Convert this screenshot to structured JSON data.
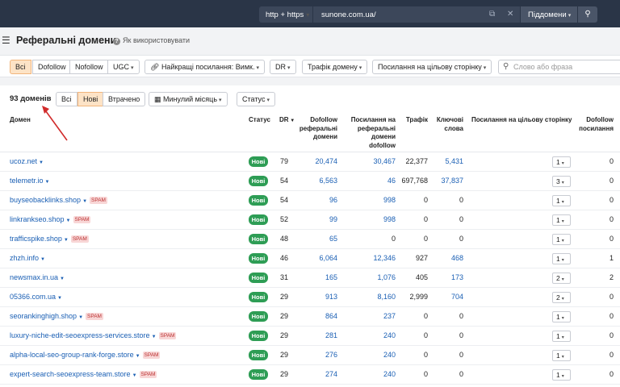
{
  "topbar": {
    "protocol": "http + https",
    "url": "sunone.com.ua/",
    "scope": "Піддомени"
  },
  "header": {
    "title": "Реферальні домени",
    "howto": "Як використовувати"
  },
  "filters": {
    "link_types": [
      "Всі",
      "Dofollow",
      "Nofollow",
      "UGC"
    ],
    "best_links": "Найкращі посилання: Вимк.",
    "dr": "DR",
    "traffic": "Трафік домену",
    "target_links": "Посилання на цільову сторінку",
    "phrase_placeholder": "Слово або фраза"
  },
  "panel": {
    "count": "93 доменів",
    "tabs": [
      "Всі",
      "Нові",
      "Втрачено"
    ],
    "period": "Минулий місяць",
    "status": "Статус"
  },
  "columns": {
    "domain": "Домен",
    "status": "Статус",
    "dr": "DR",
    "dofollow": [
      "Dofollow",
      "реферальні",
      "домени"
    ],
    "links": [
      "Посилання на",
      "реферальні",
      "домени",
      "dofollow"
    ],
    "traffic": "Трафік",
    "keywords": [
      "Ключові",
      "слова"
    ],
    "target": "Посилання на цільову сторінку",
    "dofollow_links": [
      "Dofollow",
      "посилання"
    ]
  },
  "rows": [
    {
      "domain": "ucoz.net",
      "spam": "",
      "status": "Нові",
      "dr": "79",
      "dofollow": "20,474",
      "links": "30,467",
      "traffic": "22,377",
      "keywords": "5,431",
      "target": "1",
      "df_links": "0"
    },
    {
      "domain": "telemetr.io",
      "spam": "",
      "status": "Нові",
      "dr": "54",
      "dofollow": "6,563",
      "links": "46",
      "traffic": "697,768",
      "keywords": "37,837",
      "target": "3",
      "df_links": "0"
    },
    {
      "domain": "buyseobacklinks.shop",
      "spam": "SPAM",
      "status": "Нові",
      "dr": "54",
      "dofollow": "96",
      "links": "998",
      "traffic": "0",
      "keywords": "0",
      "target": "1",
      "df_links": "0"
    },
    {
      "domain": "linkrankseo.shop",
      "spam": "SPAM",
      "status": "Нові",
      "dr": "52",
      "dofollow": "99",
      "links": "998",
      "traffic": "0",
      "keywords": "0",
      "target": "1",
      "df_links": "0"
    },
    {
      "domain": "trafficspike.shop",
      "spam": "SPAM",
      "status": "Нові",
      "dr": "48",
      "dofollow": "65",
      "links": "0",
      "traffic": "0",
      "keywords": "0",
      "target": "1",
      "df_links": "0"
    },
    {
      "domain": "zhzh.info",
      "spam": "",
      "status": "Нові",
      "dr": "46",
      "dofollow": "6,064",
      "links": "12,346",
      "traffic": "927",
      "keywords": "468",
      "target": "1",
      "df_links": "1"
    },
    {
      "domain": "newsmax.in.ua",
      "spam": "",
      "status": "Нові",
      "dr": "31",
      "dofollow": "165",
      "links": "1,076",
      "traffic": "405",
      "keywords": "173",
      "target": "2",
      "df_links": "2"
    },
    {
      "domain": "05366.com.ua",
      "spam": "",
      "status": "Нові",
      "dr": "29",
      "dofollow": "913",
      "links": "8,160",
      "traffic": "2,999",
      "keywords": "704",
      "target": "2",
      "df_links": "0"
    },
    {
      "domain": "seorankinghigh.shop",
      "spam": "SPAM",
      "status": "Нові",
      "dr": "29",
      "dofollow": "864",
      "links": "237",
      "traffic": "0",
      "keywords": "0",
      "target": "1",
      "df_links": "0"
    },
    {
      "domain": "luxury-niche-edit-seoexpress-services.store",
      "spam": "SPAM",
      "status": "Нові",
      "dr": "29",
      "dofollow": "281",
      "links": "240",
      "traffic": "0",
      "keywords": "0",
      "target": "1",
      "df_links": "0"
    },
    {
      "domain": "alpha-local-seo-group-rank-forge.store",
      "spam": "SPAM",
      "status": "Нові",
      "dr": "29",
      "dofollow": "276",
      "links": "240",
      "traffic": "0",
      "keywords": "0",
      "target": "1",
      "df_links": "0"
    },
    {
      "domain": "expert-search-seoexpress-team.store",
      "spam": "SPAM",
      "status": "Нові",
      "dr": "29",
      "dofollow": "274",
      "links": "240",
      "traffic": "0",
      "keywords": "0",
      "target": "1",
      "df_links": "0"
    }
  ]
}
